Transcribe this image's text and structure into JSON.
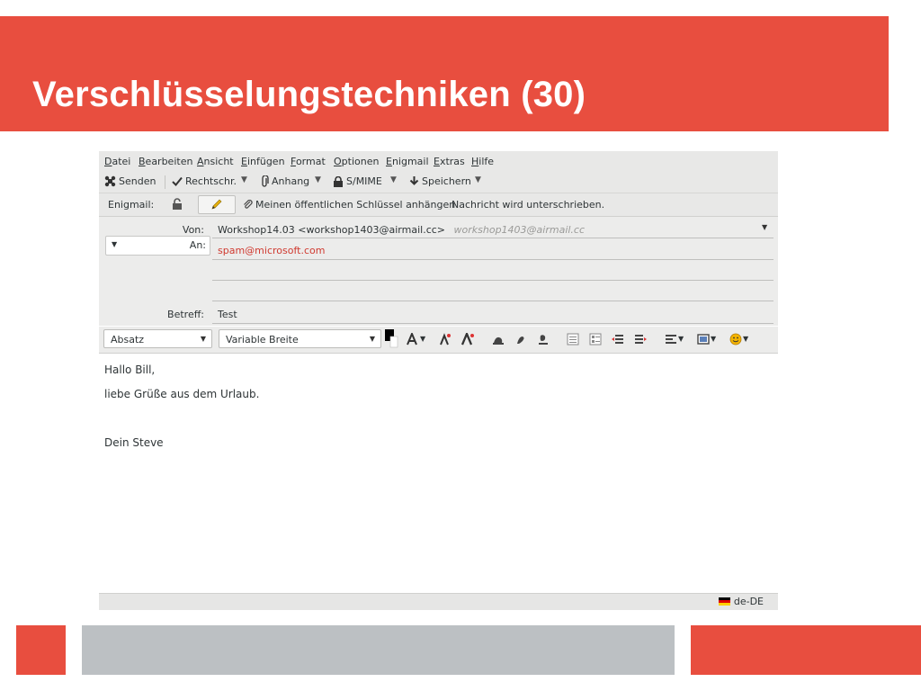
{
  "slide": {
    "title": "Verschlüsselungstechniken (30)",
    "accent_color": "#e84e3f",
    "grey_color": "#bcc0c3"
  },
  "menubar": {
    "items": [
      "Datei",
      "Bearbeiten",
      "Ansicht",
      "Einfügen",
      "Format",
      "Optionen",
      "Enigmail",
      "Extras",
      "Hilfe"
    ]
  },
  "toolbar": {
    "send_label": "Senden",
    "spelling_label": "Rechtschr.",
    "attach_label": "Anhang",
    "smime_label": "S/MIME",
    "save_label": "Speichern"
  },
  "enigmail": {
    "label": "Enigmail:",
    "attach_key_label": "Meinen öffentlichen Schlüssel anhängen",
    "status": "Nachricht wird unterschrieben."
  },
  "headers": {
    "from_label": "Von:",
    "from_value": "Workshop14.03 <workshop1403@airmail.cc>",
    "from_hint": "workshop1403@airmail.cc",
    "to_label": "An:",
    "to_value": "spam@microsoft.com",
    "subject_label": "Betreff:",
    "subject_value": "Test"
  },
  "format": {
    "paragraph_value": "Absatz",
    "font_value": "Variable Breite"
  },
  "message": {
    "lines": [
      "Hallo Bill,",
      "liebe Grüße aus dem Urlaub.",
      "Dein Steve"
    ]
  },
  "status": {
    "language": "de-DE"
  }
}
